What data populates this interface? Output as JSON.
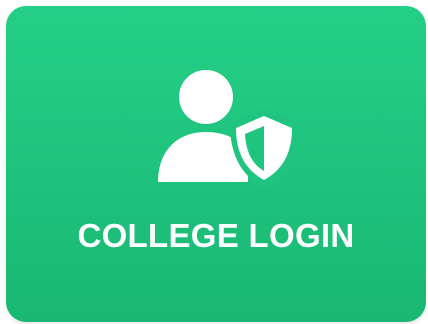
{
  "tile": {
    "label": "COLLEGE LOGIN",
    "icon": "user-shield-icon",
    "colors": {
      "background_top": "#24cf86",
      "background_bottom": "#19b772",
      "foreground": "#ffffff",
      "shield_fill": "#1fc47e"
    }
  }
}
